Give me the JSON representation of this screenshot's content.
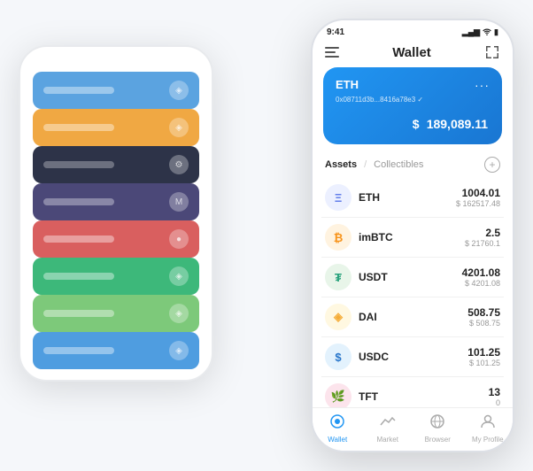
{
  "scene": {
    "back_phone": {
      "cards": [
        {
          "color": "#5ba3e0",
          "label_color": "rgba(255,255,255,0.4)",
          "icon": "◈"
        },
        {
          "color": "#f0a843",
          "label_color": "rgba(255,255,255,0.4)",
          "icon": "◈"
        },
        {
          "color": "#2d3348",
          "label_color": "rgba(255,255,255,0.3)",
          "icon": "⚙"
        },
        {
          "color": "#4b4878",
          "label_color": "rgba(255,255,255,0.35)",
          "icon": "M"
        },
        {
          "color": "#d95f5f",
          "label_color": "rgba(255,255,255,0.4)",
          "icon": "●"
        },
        {
          "color": "#3db87a",
          "label_color": "rgba(255,255,255,0.4)",
          "icon": "◈"
        },
        {
          "color": "#7dc97a",
          "label_color": "rgba(255,255,255,0.4)",
          "icon": "◈"
        },
        {
          "color": "#4f9de0",
          "label_color": "rgba(255,255,255,0.4)",
          "icon": "◈"
        }
      ]
    },
    "front_phone": {
      "status_bar": {
        "time": "9:41",
        "signal": "▂▄▆",
        "wifi": "wifi",
        "battery": "🔋"
      },
      "title": "Wallet",
      "eth_card": {
        "label": "ETH",
        "address": "0x08711d3b...8416a78e3",
        "verified": "✓",
        "balance_prefix": "$",
        "balance": "189,089.11",
        "dots": "···"
      },
      "assets_section": {
        "tab_active": "Assets",
        "separator": "/",
        "tab_inactive": "Collectibles",
        "add_icon": "+"
      },
      "assets": [
        {
          "name": "ETH",
          "icon_bg": "#ecf0ff",
          "icon_color": "#627eea",
          "icon_char": "Ξ",
          "amount": "1004.01",
          "usd": "$ 162517.48"
        },
        {
          "name": "imBTC",
          "icon_bg": "#fff3e0",
          "icon_color": "#f7931a",
          "icon_char": "₿",
          "amount": "2.5",
          "usd": "$ 21760.1"
        },
        {
          "name": "USDT",
          "icon_bg": "#e8f5e9",
          "icon_color": "#26a17b",
          "icon_char": "₮",
          "amount": "4201.08",
          "usd": "$ 4201.08"
        },
        {
          "name": "DAI",
          "icon_bg": "#fff8e1",
          "icon_color": "#f5ac37",
          "icon_char": "◈",
          "amount": "508.75",
          "usd": "$ 508.75"
        },
        {
          "name": "USDC",
          "icon_bg": "#e3f2fd",
          "icon_color": "#2775ca",
          "icon_char": "$",
          "amount": "101.25",
          "usd": "$ 101.25"
        },
        {
          "name": "TFT",
          "icon_bg": "#fce4ec",
          "icon_color": "#e91e63",
          "icon_char": "🌿",
          "amount": "13",
          "usd": "0"
        }
      ],
      "bottom_nav": [
        {
          "label": "Wallet",
          "active": true
        },
        {
          "label": "Market",
          "active": false
        },
        {
          "label": "Browser",
          "active": false
        },
        {
          "label": "My Profile",
          "active": false
        }
      ]
    }
  }
}
